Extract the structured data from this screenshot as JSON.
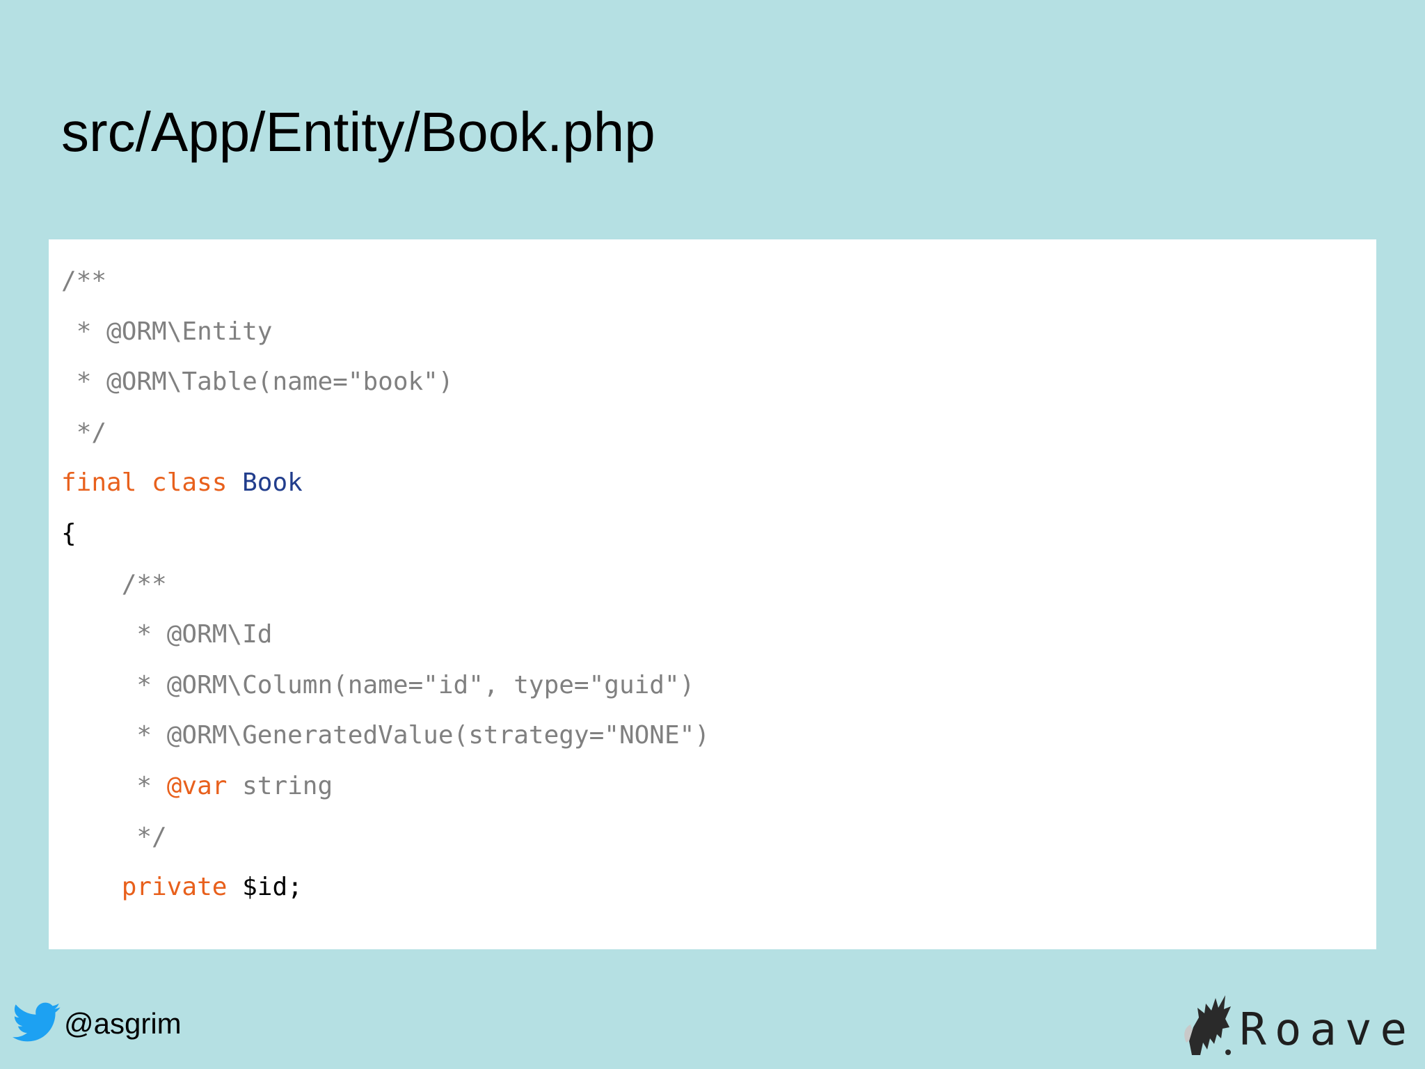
{
  "slide": {
    "title": "src/App/Entity/Book.php"
  },
  "code": {
    "lines": [
      {
        "indent": "",
        "tokens": [
          {
            "text": "/**",
            "type": "comment"
          }
        ]
      },
      {
        "indent": " ",
        "tokens": [
          {
            "text": "* @ORM\\Entity",
            "type": "comment"
          }
        ]
      },
      {
        "indent": " ",
        "tokens": [
          {
            "text": "* @ORM\\Table(name=\"book\")",
            "type": "comment"
          }
        ]
      },
      {
        "indent": " ",
        "tokens": [
          {
            "text": "*/",
            "type": "comment"
          }
        ]
      },
      {
        "indent": "",
        "tokens": [
          {
            "text": "final class",
            "type": "keyword"
          },
          {
            "text": " ",
            "type": "plain"
          },
          {
            "text": "Book",
            "type": "classname"
          }
        ]
      },
      {
        "indent": "",
        "tokens": [
          {
            "text": "{",
            "type": "plain"
          }
        ]
      },
      {
        "indent": "    ",
        "tokens": [
          {
            "text": "/**",
            "type": "comment"
          }
        ]
      },
      {
        "indent": "     ",
        "tokens": [
          {
            "text": "* @ORM\\Id",
            "type": "comment"
          }
        ]
      },
      {
        "indent": "     ",
        "tokens": [
          {
            "text": "* @ORM\\Column(name=\"id\", type=\"guid\")",
            "type": "comment"
          }
        ]
      },
      {
        "indent": "     ",
        "tokens": [
          {
            "text": "* @ORM\\GeneratedValue(strategy=\"NONE\")",
            "type": "comment"
          }
        ]
      },
      {
        "indent": "     ",
        "tokens": [
          {
            "text": "* ",
            "type": "comment"
          },
          {
            "text": "@var",
            "type": "tag"
          },
          {
            "text": " string",
            "type": "comment"
          }
        ]
      },
      {
        "indent": "     ",
        "tokens": [
          {
            "text": "*/",
            "type": "comment"
          }
        ]
      },
      {
        "indent": "    ",
        "tokens": [
          {
            "text": "private",
            "type": "keyword"
          },
          {
            "text": " $id;",
            "type": "plain"
          }
        ]
      }
    ]
  },
  "footer": {
    "handle": "@asgrim",
    "handle_icon": "twitter-bird-icon",
    "brand": "Roave",
    "brand_icon": "roave-logo-icon"
  },
  "colors": {
    "background": "#b5e0e3",
    "panel": "#ffffff",
    "comment": "#808080",
    "keyword": "#e8601c",
    "classname": "#213d8c",
    "plain": "#000000",
    "twitter": "#1da1f2"
  }
}
